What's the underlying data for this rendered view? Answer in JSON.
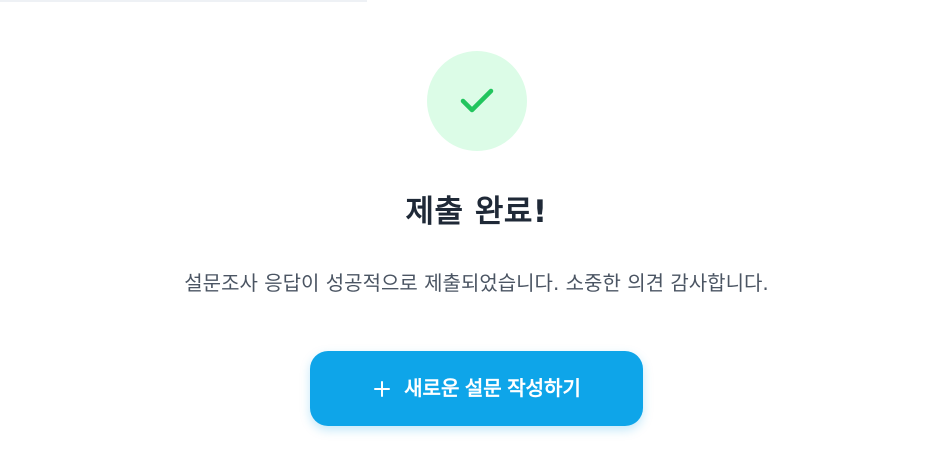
{
  "theme": {
    "success_bg": "#dcfce7",
    "success_icon": "#22c55e",
    "title_color": "#1f2937",
    "message_color": "#4b5563",
    "button_bg": "#0ea5e9",
    "button_text": "#ffffff"
  },
  "status": {
    "icon": "check-icon",
    "title": "제출 완료!",
    "message": "설문조사 응답이 성공적으로 제출되었습니다. 소중한 의견 감사합니다."
  },
  "actions": {
    "new_survey": {
      "icon": "plus-icon",
      "label": "새로운 설문 작성하기"
    }
  }
}
